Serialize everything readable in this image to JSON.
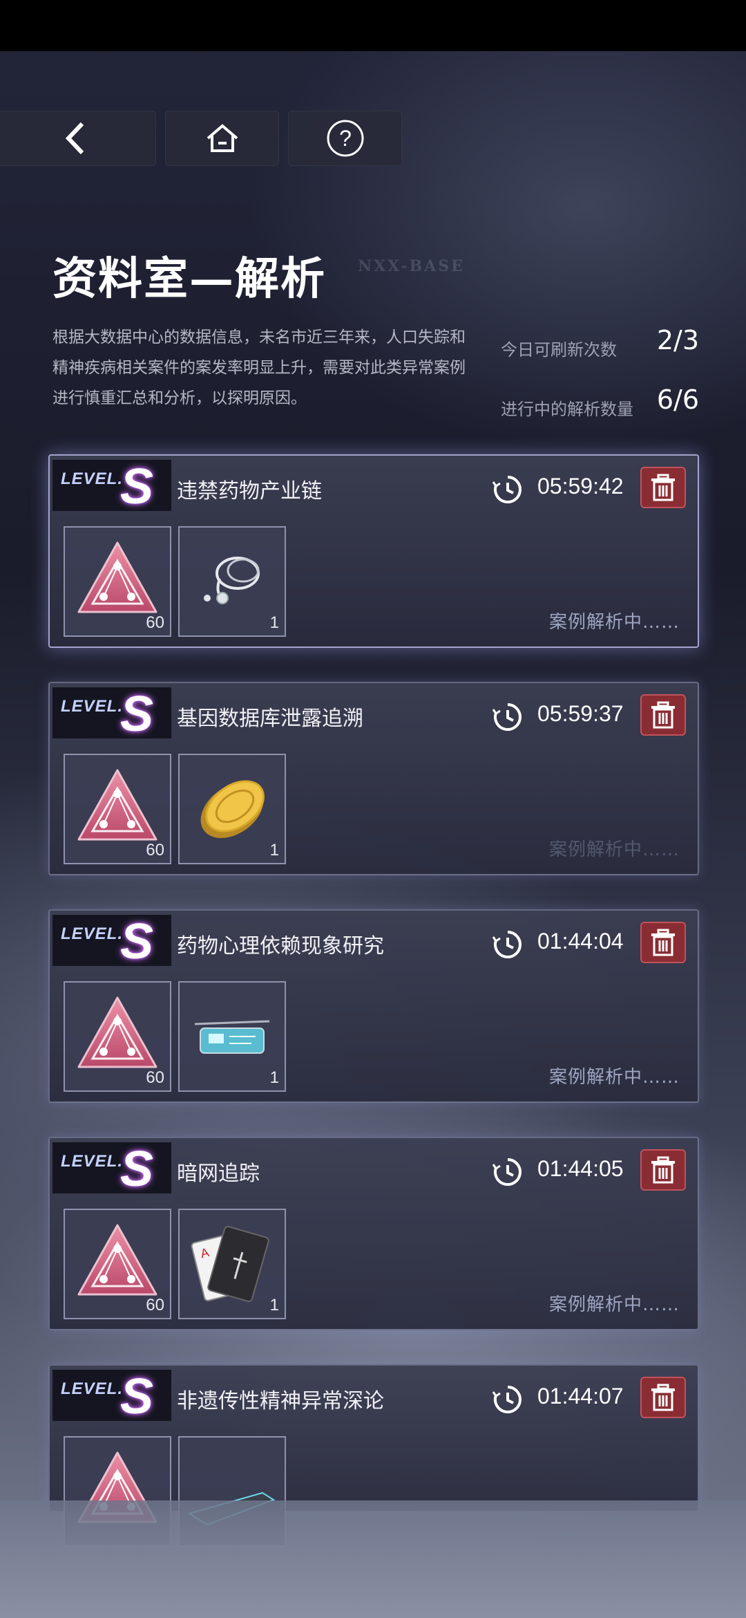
{
  "header": {
    "back_label": "back",
    "home_label": "home",
    "help_label": "help"
  },
  "page": {
    "title": "资料室—解析",
    "title_en": "NXX-BASE",
    "description": "根据大数据中心的数据信息，未名市近三年来，人口失踪和精神疾病相关案件的案发率明显上升，需要对此类异常案例进行慎重汇总和分析，以探明原因。"
  },
  "stats": {
    "refresh_label": "今日可刷新次数",
    "refresh_value": "2/3",
    "analyzing_label": "进行中的解析数量",
    "analyzing_value": "6/6"
  },
  "level_prefix": "LEVEL.",
  "cases": [
    {
      "level": "S",
      "name": "违禁药物产业链",
      "timer": "05:59:42",
      "item1_count": "60",
      "item2_count": "1",
      "item2_icon": "stethoscope-icon",
      "status": "案例解析中……"
    },
    {
      "level": "S",
      "name": "基因数据库泄露追溯",
      "timer": "05:59:37",
      "item1_count": "60",
      "item2_count": "1",
      "item2_icon": "gold-coin-icon",
      "status": "案例解析中……"
    },
    {
      "level": "S",
      "name": "药物心理依赖现象研究",
      "timer": "01:44:04",
      "item1_count": "60",
      "item2_count": "1",
      "item2_icon": "tech-glasses-icon",
      "status": "案例解析中……"
    },
    {
      "level": "S",
      "name": "暗网追踪",
      "timer": "01:44:05",
      "item1_count": "60",
      "item2_count": "1",
      "item2_icon": "playing-cards-icon",
      "status": "案例解析中……"
    },
    {
      "level": "S",
      "name": "非遗传性精神异常深论",
      "timer": "01:44:07",
      "item1_count": "",
      "item2_count": "",
      "item2_icon": "pistol-icon",
      "status": ""
    }
  ],
  "colors": {
    "accent_red": "#8a2c33",
    "level_glow": "#d86bff",
    "status_text": "#9fa6c2"
  }
}
